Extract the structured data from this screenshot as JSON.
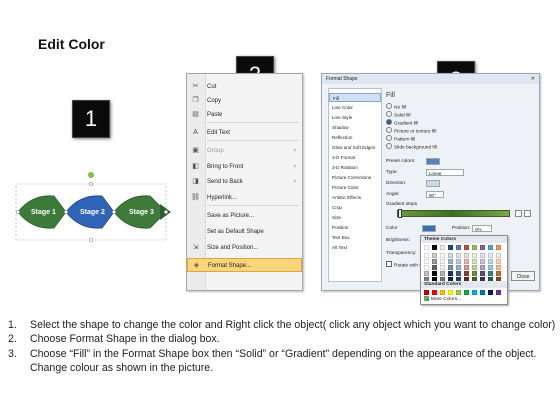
{
  "title": "Edit Color",
  "badges": [
    "1",
    "2",
    "3"
  ],
  "stages": [
    "Stage 1",
    "Stage 2",
    "Stage 3"
  ],
  "context_menu": {
    "items": [
      {
        "label": "Cut",
        "icon": "scissors-icon",
        "glyph": "✂"
      },
      {
        "label": "Copy",
        "icon": "copy-icon",
        "glyph": "❐"
      },
      {
        "label": "Paste",
        "icon": "paste-icon",
        "glyph": "▤"
      },
      {
        "label": "Edit Text",
        "icon": "edit-text-icon",
        "glyph": "A"
      },
      {
        "label": "Group",
        "icon": "group-icon",
        "glyph": "▣"
      },
      {
        "label": "Bring to Front",
        "icon": "bring-front-icon",
        "glyph": "◧"
      },
      {
        "label": "Send to Back",
        "icon": "send-back-icon",
        "glyph": "◨"
      },
      {
        "label": "Hyperlink...",
        "icon": "hyperlink-icon",
        "glyph": "⛓"
      },
      {
        "label": "Save as Picture...",
        "icon": "",
        "glyph": ""
      },
      {
        "label": "Set as Default Shape",
        "icon": "",
        "glyph": ""
      },
      {
        "label": "Size and Position...",
        "icon": "size-position-icon",
        "glyph": "⇲"
      },
      {
        "label": "Format Shape...",
        "icon": "format-shape-icon",
        "glyph": "◈"
      }
    ],
    "highlighted": "Format Shape..."
  },
  "format_shape": {
    "caption": "Format Shape",
    "nav": [
      "Fill",
      "Line Color",
      "Line Style",
      "Shadow",
      "Reflection",
      "Glow and Soft Edges",
      "3-D Format",
      "3-D Rotation",
      "Picture Corrections",
      "Picture Color",
      "Artistic Effects",
      "Crop",
      "Size",
      "Position",
      "Text Box",
      "Alt Text"
    ],
    "selected_nav": "Fill",
    "heading": "Fill",
    "options": [
      "No fill",
      "Solid fill",
      "Gradient fill",
      "Picture or texture fill",
      "Pattern fill",
      "Slide background fill"
    ],
    "selected_option": "Gradient fill",
    "preset_colors_label": "Preset colors:",
    "type_label": "Type:",
    "type_value": "Linear",
    "direction_label": "Direction:",
    "angle_label": "Angle:",
    "angle_value": "90°",
    "gradient_stops_label": "Gradient stops",
    "color_label": "Color",
    "position_label": "Position:",
    "position_value": "0%",
    "brightness_label": "Brightness:",
    "transparency_label": "Transparency:",
    "rotate_label": "Rotate with shape",
    "close_label": "Close"
  },
  "color_picker": {
    "theme_label": "Theme Colors",
    "standard_label": "Standard Colors",
    "more_label": "More Colors...",
    "theme_top": [
      "#ffffff",
      "#000000",
      "#eeece1",
      "#1f497d",
      "#4f81bd",
      "#c0504d",
      "#9bbb59",
      "#8064a2",
      "#4bacc6",
      "#f79646"
    ],
    "standard": [
      "#c00000",
      "#ff0000",
      "#ffc000",
      "#ffff00",
      "#92d050",
      "#00b050",
      "#00b0f0",
      "#0070c0",
      "#002060",
      "#7030a0"
    ]
  },
  "instructions": [
    {
      "num": "1.",
      "text": "Select the shape to change the color and Right click the object( click any object which you want to change color)"
    },
    {
      "num": "2.",
      "text": "Choose Format Shape in the dialog box."
    },
    {
      "num": "3.",
      "text": "Choose “Fill” in the Format Shape box then “Solid” or “Gradient” depending on the appearance of the object. Change colour as shown in the picture."
    }
  ]
}
